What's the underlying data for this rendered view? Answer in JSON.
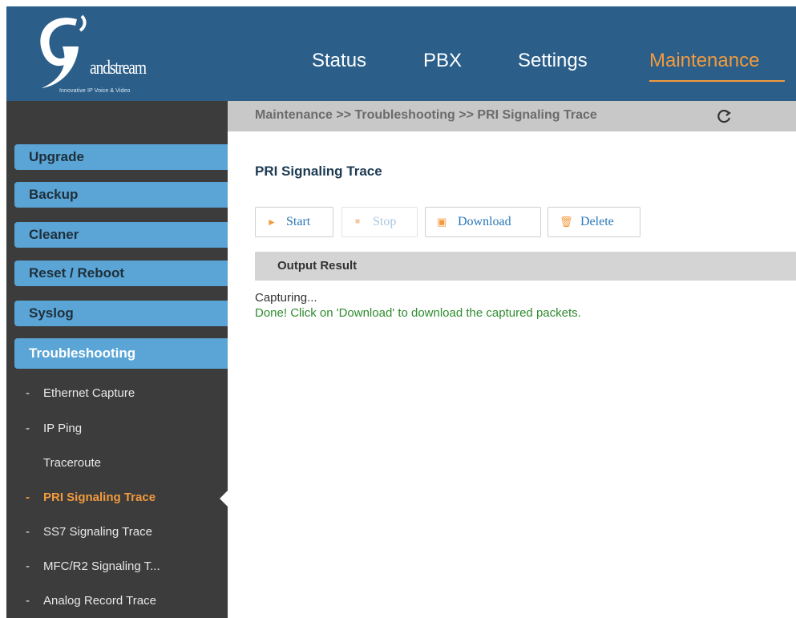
{
  "app": {
    "logo_letter": "G",
    "logo_brand": "andstream",
    "logo_tagline": "Innovative IP Voice & Video"
  },
  "nav": {
    "items": [
      {
        "label": "Status",
        "active": false
      },
      {
        "label": "PBX",
        "active": false
      },
      {
        "label": "Settings",
        "active": false
      },
      {
        "label": "Maintenance",
        "active": true
      }
    ]
  },
  "breadcrumb": "Maintenance >> Troubleshooting >> PRI Signaling Trace",
  "sidebar": {
    "sections": [
      {
        "label": "Upgrade"
      },
      {
        "label": "Backup"
      },
      {
        "label": "Cleaner"
      },
      {
        "label": "Reset / Reboot"
      },
      {
        "label": "Syslog"
      },
      {
        "label": "Troubleshooting",
        "active": true
      }
    ],
    "subitems": [
      {
        "label": "Ethernet Capture",
        "dash": "-"
      },
      {
        "label": "IP Ping",
        "dash": "-"
      },
      {
        "label": "Traceroute",
        "dash": ""
      },
      {
        "label": "PRI Signaling Trace",
        "dash": "-",
        "active": true
      },
      {
        "label": "SS7 Signaling Trace",
        "dash": "-"
      },
      {
        "label": "MFC/R2 Signaling T...",
        "dash": "-"
      },
      {
        "label": "Analog Record Trace",
        "dash": "-"
      }
    ]
  },
  "main": {
    "title": "PRI Signaling Trace",
    "buttons": {
      "start": "Start",
      "stop": "Stop",
      "download": "Download",
      "delete": "Delete"
    },
    "output_label": "Output Result",
    "output_lines": [
      "Capturing...",
      "Done! Click on 'Download' to download the captured packets."
    ]
  },
  "colors": {
    "header_bg": "#2b5f8a",
    "accent_orange": "#f29a3e",
    "sidebar_button": "#5aa5d6",
    "success_text": "#2e8b2e",
    "link_blue": "#2a77b8"
  }
}
